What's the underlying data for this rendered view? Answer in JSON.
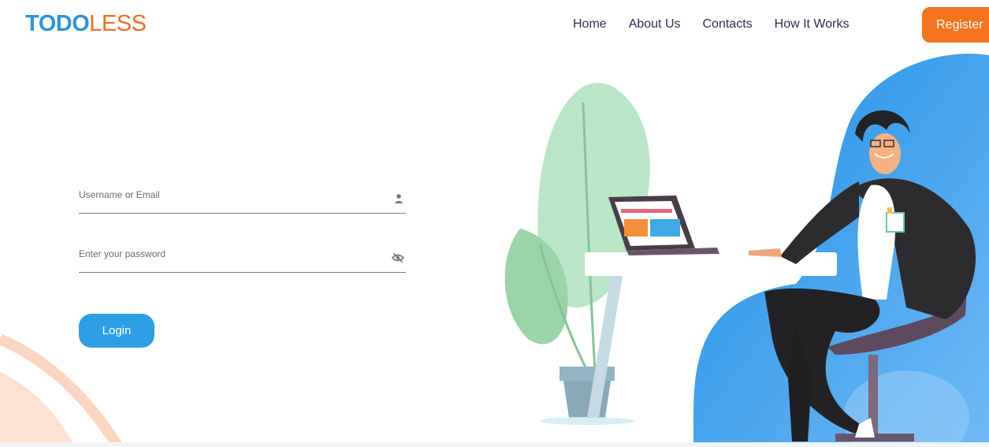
{
  "header": {
    "logo_part1": "TODO",
    "logo_part2": "LESS",
    "nav": [
      "Home",
      "About Us",
      "Contacts",
      "How It Works"
    ],
    "register_label": "Register"
  },
  "login_form": {
    "username_placeholder": "Username or Email",
    "password_placeholder": "Enter your password",
    "login_label": "Login",
    "username_icon": "user-icon",
    "password_icon": "eye-off-icon"
  },
  "colors": {
    "brand_blue": "#2f93dc",
    "brand_orange": "#f06d22",
    "register_bg": "#f3731e",
    "login_bg": "#2d9fe5"
  }
}
